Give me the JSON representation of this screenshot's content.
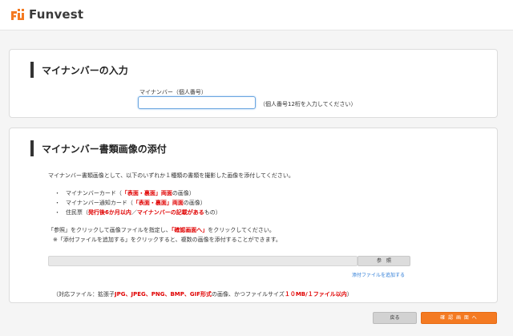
{
  "brand": {
    "name": "Funvest",
    "accent": "#f47a22"
  },
  "section1": {
    "title": "マイナンバーの入力",
    "field_label": "マイナンバー（個人番号）",
    "input_value": "",
    "hint": "（個人番号12桁を入力してください）"
  },
  "section2": {
    "title": "マイナンバー書類画像の添付",
    "description": "マイナンバー書類画像として、以下のいずれか１種類の書類を撮影した画像を添付してください。",
    "items": [
      {
        "bullet": "・",
        "pre": "マイナンバーカード（",
        "red": "「表面・裏面」両面",
        "post": "の画像）"
      },
      {
        "bullet": "・",
        "pre": "マイナンバー通知カード（",
        "red": "「表面・裏面」両面",
        "post": "の画像）"
      },
      {
        "bullet": "・",
        "pre": "住民票（",
        "red": "発行後6か月以内",
        "mid": "／",
        "red2": "マイナンバーの記載がある",
        "post": "もの）"
      }
    ],
    "note_line1_pre": "「参照」をクリックして画像ファイルを指定し、",
    "note_line1_red": "「確認画面へ」",
    "note_line1_post": "をクリックしてください。",
    "note_line2": "※「添付ファイルを追加する」をクリックすると、複数の画像を添付することができます。",
    "browse_label": "参　照",
    "add_file_label": "添付ファイルを追加する",
    "filetypes_pre": "（対応ファイル：拡張子",
    "filetypes_red": "JPG、JPEG、PNG、BMP、GIF形式",
    "filetypes_mid": "の画像、かつファイルサイズ",
    "filetypes_red2": "１０MB/１ファイル以内",
    "filetypes_post": "）"
  },
  "footer": {
    "back_label": "戻る",
    "confirm_label": "確 認 画 面 へ"
  }
}
